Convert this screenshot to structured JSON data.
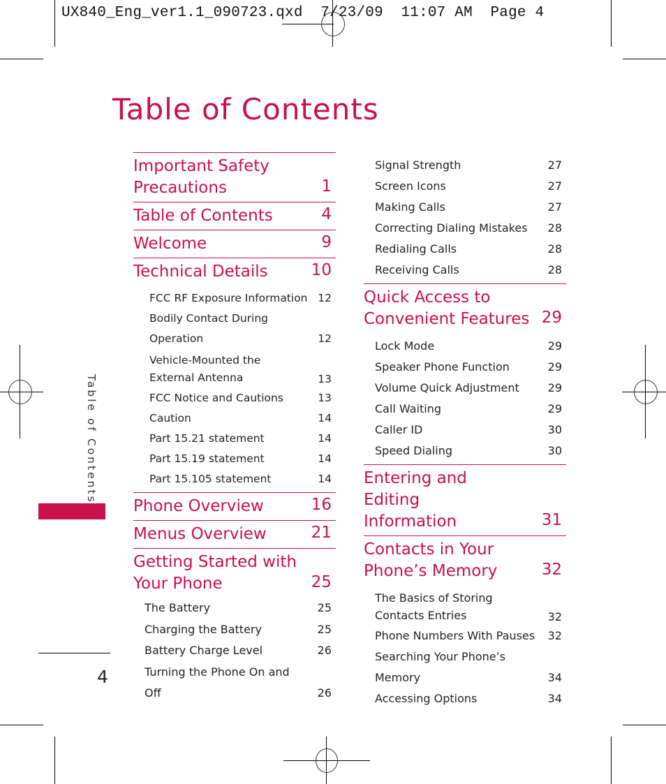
{
  "slug": "UX840_Eng_ver1.1_090723.qxd  7/23/09  11:07 AM  Page 4",
  "title": "Table of Contents",
  "side_label": "Table of Contents",
  "page_number": "4",
  "accent_color": "#c8104a",
  "left_column": [
    {
      "label": "Important Safety Precautions",
      "page": "1",
      "subs": []
    },
    {
      "label": "Table of Contents",
      "page": "4",
      "subs": []
    },
    {
      "label": "Welcome",
      "page": "9",
      "subs": []
    },
    {
      "label": "Technical Details",
      "page": "10",
      "subs": [
        {
          "label": "FCC RF Exposure Information",
          "page": "12"
        },
        {
          "label": "Bodily Contact During Operation",
          "page": "12"
        },
        {
          "label": "Vehicle-Mounted the External Antenna",
          "page": "13"
        },
        {
          "label": "FCC Notice and Cautions",
          "page": "13"
        },
        {
          "label": "Caution",
          "page": "14"
        },
        {
          "label": "Part 15.21 statement",
          "page": "14"
        },
        {
          "label": "Part 15.19 statement",
          "page": "14"
        },
        {
          "label": "Part 15.105 statement",
          "page": "14"
        }
      ]
    },
    {
      "label": "Phone Overview",
      "page": "16",
      "subs": []
    },
    {
      "label": "Menus Overview",
      "page": "21",
      "subs": []
    },
    {
      "label": "Getting Started with Your Phone",
      "page": "25",
      "subs": [
        {
          "label": "The Battery",
          "page": "25"
        },
        {
          "label": "Charging the Battery",
          "page": "25"
        },
        {
          "label": "Battery Charge Level",
          "page": "26"
        },
        {
          "label": "Turning the Phone On and Off",
          "page": "26"
        }
      ]
    }
  ],
  "right_column": {
    "continued_subs": [
      {
        "label": "Signal Strength",
        "page": "27"
      },
      {
        "label": "Screen Icons",
        "page": "27"
      },
      {
        "label": "Making Calls",
        "page": "27"
      },
      {
        "label": "Correcting Dialing Mistakes",
        "page": "28"
      },
      {
        "label": "Redialing Calls",
        "page": "28"
      },
      {
        "label": "Receiving Calls",
        "page": "28"
      }
    ],
    "sections": [
      {
        "label": "Quick Access to Convenient Features",
        "page": "29",
        "subs": [
          {
            "label": "Lock Mode",
            "page": "29"
          },
          {
            "label": "Speaker Phone Function",
            "page": "29"
          },
          {
            "label": "Volume Quick Adjustment",
            "page": "29"
          },
          {
            "label": "Call Waiting",
            "page": "29"
          },
          {
            "label": "Caller ID",
            "page": "30"
          },
          {
            "label": "Speed Dialing",
            "page": "30"
          }
        ]
      },
      {
        "label": "Entering and Editing Information",
        "page": "31",
        "subs": []
      },
      {
        "label": "Contacts in Your Phone’s Memory",
        "page": "32",
        "subs": [
          {
            "label": "The Basics of Storing Contacts Entries",
            "page": "32"
          },
          {
            "label": "Phone Numbers With Pauses",
            "page": "32"
          },
          {
            "label": "Searching Your Phone’s Memory",
            "page": "34"
          },
          {
            "label": "Accessing Options",
            "page": "34"
          }
        ]
      }
    ]
  }
}
